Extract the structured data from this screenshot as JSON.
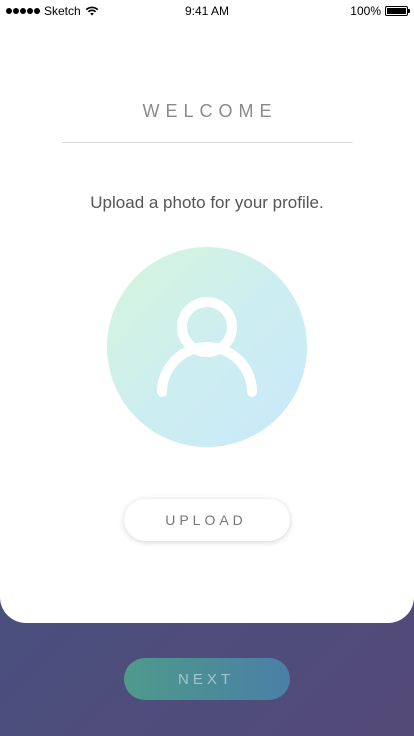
{
  "status_bar": {
    "carrier": "Sketch",
    "time": "9:41 AM",
    "battery": "100%"
  },
  "welcome": {
    "title": "WELCOME",
    "subtitle": "Upload a photo for your profile."
  },
  "avatar": {
    "icon": "person-icon",
    "gradient_start": "#d6f5da",
    "gradient_end": "#c9e8fb"
  },
  "buttons": {
    "upload_label": "UPLOAD",
    "next_label": "NEXT"
  },
  "colors": {
    "background_start": "#3f5f86",
    "background_end": "#544a78",
    "next_gradient_start": "#4e9a8b",
    "next_gradient_end": "#4a7fa6"
  }
}
